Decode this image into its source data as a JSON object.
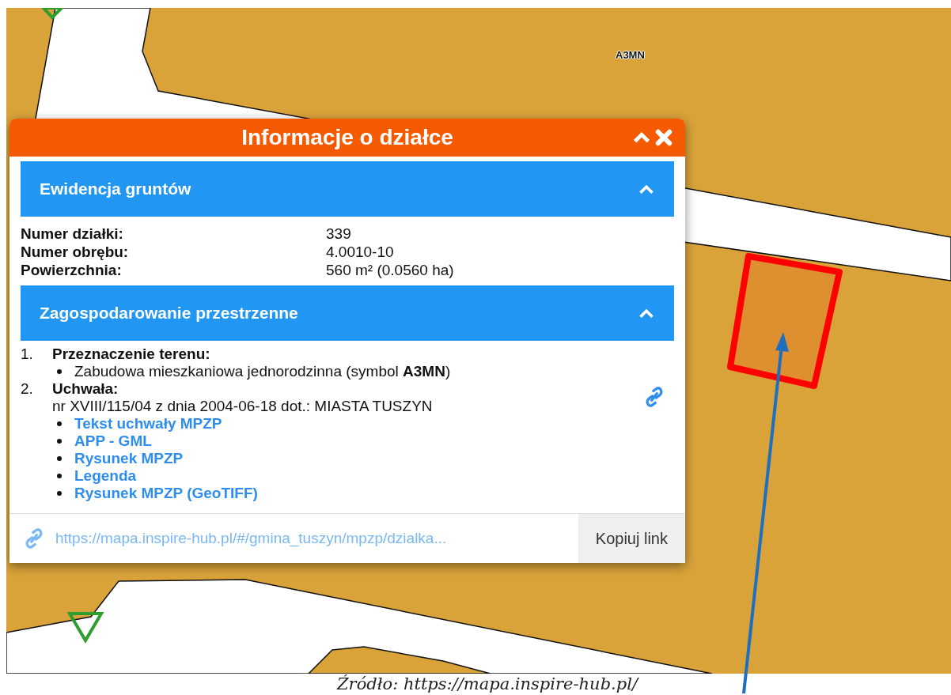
{
  "map": {
    "label": "A3MN"
  },
  "popup": {
    "title": "Informacje o działce",
    "collapsed": false,
    "sections": [
      {
        "kind": "fields",
        "title": "Ewidencja gruntów",
        "expanded": true,
        "fields": [
          {
            "label": "Numer działki:",
            "value": "339"
          },
          {
            "label": "Numer obrębu:",
            "value": "4.0010-10"
          },
          {
            "label": "Powierzchnia:",
            "value": "560 m² (0.0560 ha)"
          }
        ]
      },
      {
        "kind": "plan",
        "title": "Zagospodarowanie przestrzenne",
        "expanded": true,
        "items": [
          {
            "number": "1.",
            "heading": "Przeznaczenie terenu:",
            "link_icon": false,
            "bullets": [
              {
                "kind": "text",
                "text": "Zabudowa mieszkaniowa jednorodzinna (symbol **A3MN**)"
              }
            ]
          },
          {
            "number": "2.",
            "heading": "Uchwała:",
            "text": "nr XVIII/115/04 z dnia 2004-06-18 dot.: MIASTA TUSZYN",
            "link_icon": true,
            "bullets": [
              {
                "kind": "link",
                "text": "Tekst uchwały MPZP"
              },
              {
                "kind": "link",
                "text": "APP - GML"
              },
              {
                "kind": "link",
                "text": "Rysunek MPZP"
              },
              {
                "kind": "link",
                "text": "Legenda"
              },
              {
                "kind": "link",
                "text": "Rysunek MPZP (GeoTIFF)"
              }
            ]
          }
        ]
      }
    ],
    "footer": {
      "url": "https://mapa.inspire-hub.pl/#/gmina_tuszyn/mpzp/dzialka...",
      "copy_button": "Kopiuj link"
    }
  },
  "caption": "Źródło: https://mapa.inspire-hub.pl/"
}
